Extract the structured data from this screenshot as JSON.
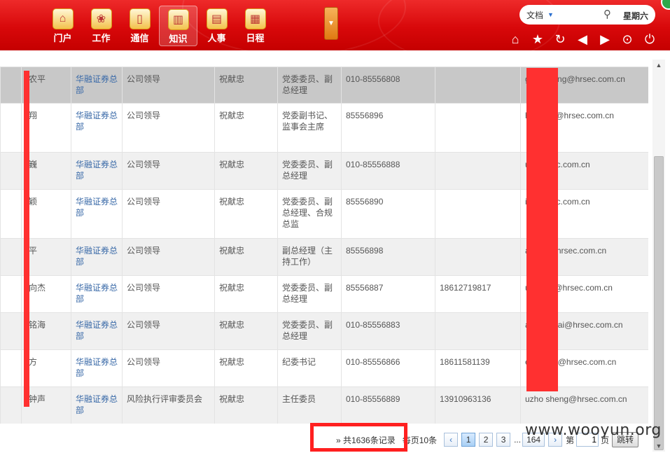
{
  "nav": {
    "items": [
      {
        "label": "门户",
        "icon": "home-icon"
      },
      {
        "label": "工作",
        "icon": "work-icon"
      },
      {
        "label": "通信",
        "icon": "phone-icon"
      },
      {
        "label": "知识",
        "icon": "book-icon",
        "active": true
      },
      {
        "label": "人事",
        "icon": "document-icon"
      },
      {
        "label": "日程",
        "icon": "calendar-icon"
      }
    ]
  },
  "search": {
    "type_label": "文档",
    "weekday": "星期六"
  },
  "toolbar": {
    "icons": [
      "home-icon",
      "star-icon",
      "refresh-icon",
      "back-icon",
      "forward-icon",
      "menu-icon",
      "power-icon"
    ]
  },
  "table": {
    "rows": [
      {
        "name": "农平",
        "company": "华融证券总部",
        "dept": "公司领导",
        "leader": "祝献忠",
        "title": "党委委员、副总经理",
        "phone": "010-85556808",
        "mobile": "",
        "email": "guono  ping@hrsec.com.cn"
      },
      {
        "name": "翔",
        "company": "华融证券总部",
        "dept": "公司领导",
        "leader": "祝献忠",
        "title": "党委副书记、监事会主席",
        "phone": "85556896",
        "mobile": "",
        "email": "hang  ng@hrsec.com.cn"
      },
      {
        "name": "巍",
        "company": "华融证券总部",
        "dept": "公司领导",
        "leader": "祝献忠",
        "title": "党委委员、副总经理",
        "phone": "010-85556888",
        "mobile": "",
        "email": "uwei  rsec.com.cn"
      },
      {
        "name": "颖",
        "company": "华融证券总部",
        "dept": "公司领导",
        "leader": "祝献忠",
        "title": "党委委员、副总经理、合规总监",
        "phone": "85556890",
        "mobile": "",
        "email": "iying  rsec.com.cn"
      },
      {
        "name": "平",
        "company": "华融证券总部",
        "dept": "公司领导",
        "leader": "祝献忠",
        "title": "副总经理（主持工作）",
        "phone": "85556898",
        "mobile": "",
        "email": "anpin  @hrsec.com.cn"
      },
      {
        "name": "向杰",
        "company": "华融证券总部",
        "dept": "公司领导",
        "leader": "祝献忠",
        "title": "党委委员、副总经理",
        "phone": "85556887",
        "mobile": "18612719817",
        "email": "uxian  ie@hrsec.com.cn"
      },
      {
        "name": "铭海",
        "company": "华融证券总部",
        "dept": "公司领导",
        "leader": "祝献忠",
        "title": "党委委员、副总经理",
        "phone": "010-85556883",
        "mobile": "",
        "email": "angm  ghai@hrsec.com.cn"
      },
      {
        "name": "方",
        "company": "华融证券总部",
        "dept": "公司领导",
        "leader": "祝献忠",
        "title": "纪委书记",
        "phone": "010-85556866",
        "mobile": "18611581139",
        "email": "eengf  ng@hrsec.com.cn"
      },
      {
        "name": "钟声",
        "company": "华融证券总部",
        "dept": "风险执行评审委员会",
        "leader": "祝献忠",
        "title": "主任委员",
        "phone": "010-85556889",
        "mobile": "13910963136",
        "email": "uzho  sheng@hrsec.com.cn"
      }
    ]
  },
  "pager": {
    "total_text": "» 共1636条记录",
    "per_page_text": "每页10条",
    "prev": "‹",
    "pages": [
      "1",
      "2",
      "3"
    ],
    "ellipsis": "...",
    "last": "164",
    "next": "›",
    "goto_prefix": "第",
    "goto_value": "1",
    "goto_suffix": "页",
    "goto_button": "跳转"
  },
  "watermark": "www.wooyun.org"
}
